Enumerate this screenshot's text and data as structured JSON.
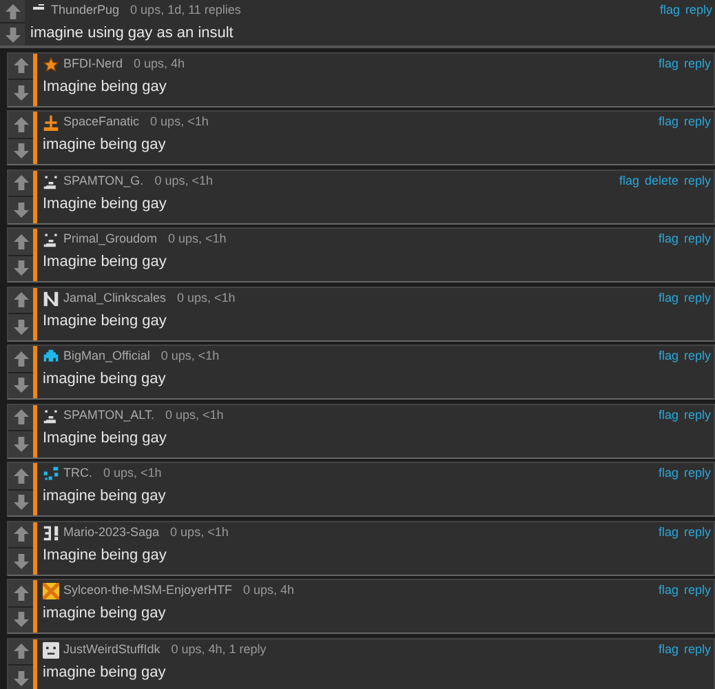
{
  "comment": {
    "avatar": {
      "kind": "dash"
    },
    "username": "ThunderPug",
    "meta": "0 ups, 1d, 11 replies",
    "text": "imagine using gay as an insult",
    "actions": [
      "flag",
      "reply"
    ]
  },
  "replies": [
    {
      "avatar": {
        "kind": "star"
      },
      "username": "BFDI-Nerd",
      "meta": "0 ups, 4h",
      "text": "Imagine being gay",
      "actions": [
        "flag",
        "reply"
      ]
    },
    {
      "avatar": {
        "kind": "cross"
      },
      "username": "SpaceFanatic",
      "meta": "0 ups, <1h",
      "text": "imagine being gay",
      "actions": [
        "flag",
        "reply"
      ]
    },
    {
      "avatar": {
        "kind": "pixel"
      },
      "username": "SPAMTON_G.",
      "meta": "0 ups, <1h",
      "text": "Imagine being gay",
      "actions": [
        "flag",
        "delete",
        "reply"
      ]
    },
    {
      "avatar": {
        "kind": "pixel"
      },
      "username": "Primal_Groudom",
      "meta": "0 ups, <1h",
      "text": "Imagine being gay",
      "actions": [
        "flag",
        "reply"
      ]
    },
    {
      "avatar": {
        "kind": "letter"
      },
      "username": "Jamal_Clinkscales",
      "meta": "0 ups, <1h",
      "text": "Imagine being gay",
      "actions": [
        "flag",
        "reply"
      ]
    },
    {
      "avatar": {
        "kind": "invader"
      },
      "username": "BigMan_Official",
      "meta": "0 ups, <1h",
      "text": "imagine being gay",
      "actions": [
        "flag",
        "reply"
      ]
    },
    {
      "avatar": {
        "kind": "pixel"
      },
      "username": "SPAMTON_ALT.",
      "meta": "0 ups, <1h",
      "text": "Imagine being gay",
      "actions": [
        "flag",
        "reply"
      ]
    },
    {
      "avatar": {
        "kind": "squares"
      },
      "username": "TRC.",
      "meta": "0 ups, <1h",
      "text": "imagine being gay",
      "actions": [
        "flag",
        "reply"
      ]
    },
    {
      "avatar": {
        "kind": "bang"
      },
      "username": "Mario-2023-Saga",
      "meta": "0 ups, <1h",
      "text": "Imagine being gay",
      "actions": [
        "flag",
        "reply"
      ]
    },
    {
      "avatar": {
        "kind": "tile"
      },
      "username": "Sylceon-the-MSM-EnjoyerHTF",
      "meta": "0 ups, 4h",
      "text": "imagine being gay",
      "actions": [
        "flag",
        "reply"
      ]
    },
    {
      "avatar": {
        "kind": "face"
      },
      "username": "JustWeirdStuffIdk",
      "meta": "0 ups, 4h, 1 reply",
      "text": "imagine being gay",
      "actions": [
        "flag",
        "reply"
      ]
    }
  ]
}
